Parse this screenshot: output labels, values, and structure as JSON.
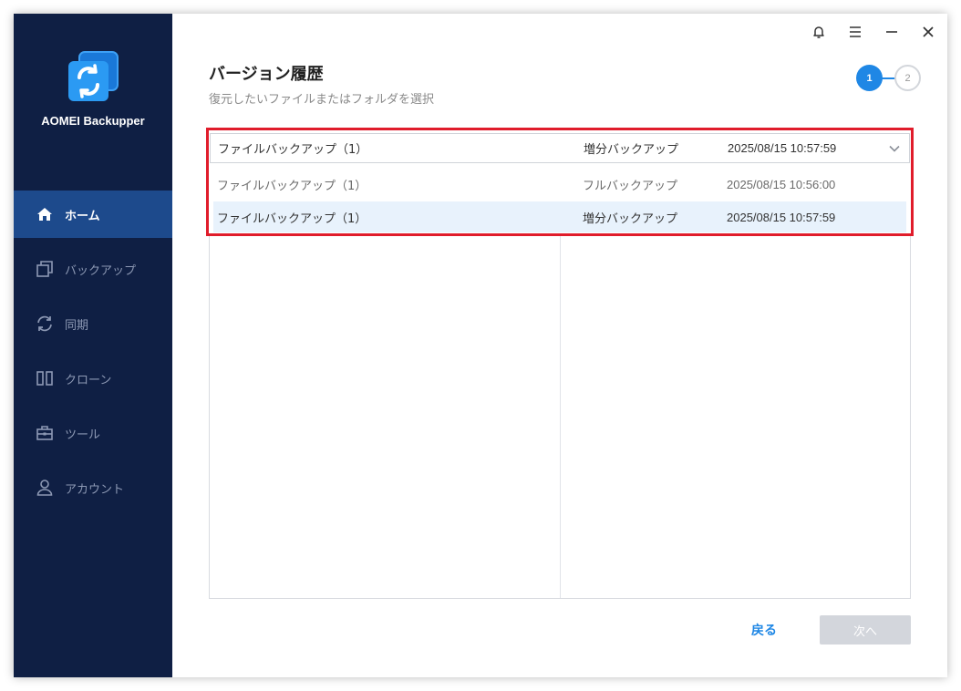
{
  "app": {
    "name": "AOMEI Backupper"
  },
  "sidebar": {
    "items": [
      {
        "label": "ホーム",
        "icon": "home-icon",
        "active": true
      },
      {
        "label": "バックアップ",
        "icon": "backup-icon",
        "active": false
      },
      {
        "label": "同期",
        "icon": "sync-icon",
        "active": false
      },
      {
        "label": "クローン",
        "icon": "clone-icon",
        "active": false
      },
      {
        "label": "ツール",
        "icon": "toolbox-icon",
        "active": false
      },
      {
        "label": "アカウント",
        "icon": "user-icon",
        "active": false
      }
    ]
  },
  "titlebar": {
    "icons": [
      "bell-icon",
      "menu-icon",
      "minimize-icon",
      "close-icon"
    ]
  },
  "page": {
    "title": "バージョン履歴",
    "subtitle": "復元したいファイルまたはフォルダを選択"
  },
  "steps": {
    "current": "1",
    "next": "2"
  },
  "version_select": {
    "selected": {
      "name": "ファイルバックアップ（1）",
      "type": "増分バックアップ",
      "date": "2025/08/15 10:57:59"
    },
    "options": [
      {
        "name": "ファイルバックアップ（1）",
        "type": "フルバックアップ",
        "date": "2025/08/15 10:56:00"
      },
      {
        "name": "ファイルバックアップ（1）",
        "type": "増分バックアップ",
        "date": "2025/08/15 10:57:59"
      }
    ]
  },
  "footer": {
    "back_label": "戻る",
    "next_label": "次へ"
  },
  "colors": {
    "sidebar_bg": "#0f1f44",
    "sidebar_active": "#1d4a8c",
    "accent": "#1f87e5",
    "highlight_border": "#e01c2b",
    "selected_row": "#e8f2fc",
    "disabled_button": "#d3d6dc"
  }
}
